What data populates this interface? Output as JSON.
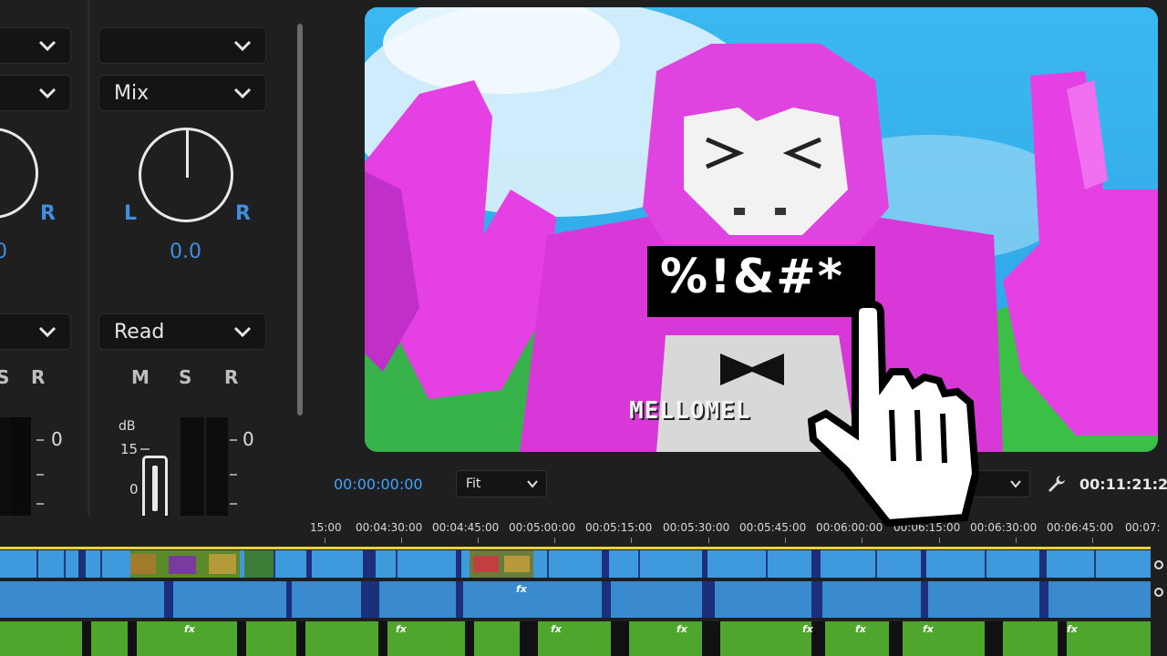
{
  "mixer": {
    "left_channel": {
      "mode_value": "",
      "pan_left_label": "",
      "pan_right_label": "R",
      "pan_value": "0",
      "automation_value": "",
      "mute": "",
      "solo": "S",
      "record": "R",
      "meter_zero": "0"
    },
    "right_channel": {
      "top_dropdown_value": "",
      "mode_value": "Mix",
      "pan_left_label": "L",
      "pan_right_label": "R",
      "pan_value": "0.0",
      "automation_value": "Read",
      "mute": "M",
      "solo": "S",
      "record": "R",
      "db_label": "dB",
      "db_scale_15": "15",
      "db_scale_0": "0",
      "meter_zero": "0"
    }
  },
  "monitor": {
    "overlay_text": "%!&#*",
    "shirt_text": "MELLOMEL",
    "current_timecode": "00:00:00:00",
    "zoom_value": "Fit",
    "duration_timecode": "00:11:21:2",
    "colors": {
      "timecode": "#3ea3ff",
      "sky": "#35b3ec",
      "gorilla": "#e040e0"
    }
  },
  "timeline": {
    "ruler_labels": [
      "15:00",
      "00:04:30:00",
      "00:04:45:00",
      "00:05:00:00",
      "00:05:15:00",
      "00:05:30:00",
      "00:05:45:00",
      "00:06:00:00",
      "00:06:15:00",
      "00:06:30:00",
      "00:06:45:00",
      "00:07:"
    ],
    "fx_label": "fx",
    "colors": {
      "video": "#3e99dd",
      "audio": "#3a8ad0",
      "music": "#4ea62c",
      "playhead": "#e8d23a"
    }
  },
  "icons": [
    "chevron-down-icon",
    "wrench-icon",
    "hand-pointer-icon",
    "bow-tie-icon"
  ]
}
